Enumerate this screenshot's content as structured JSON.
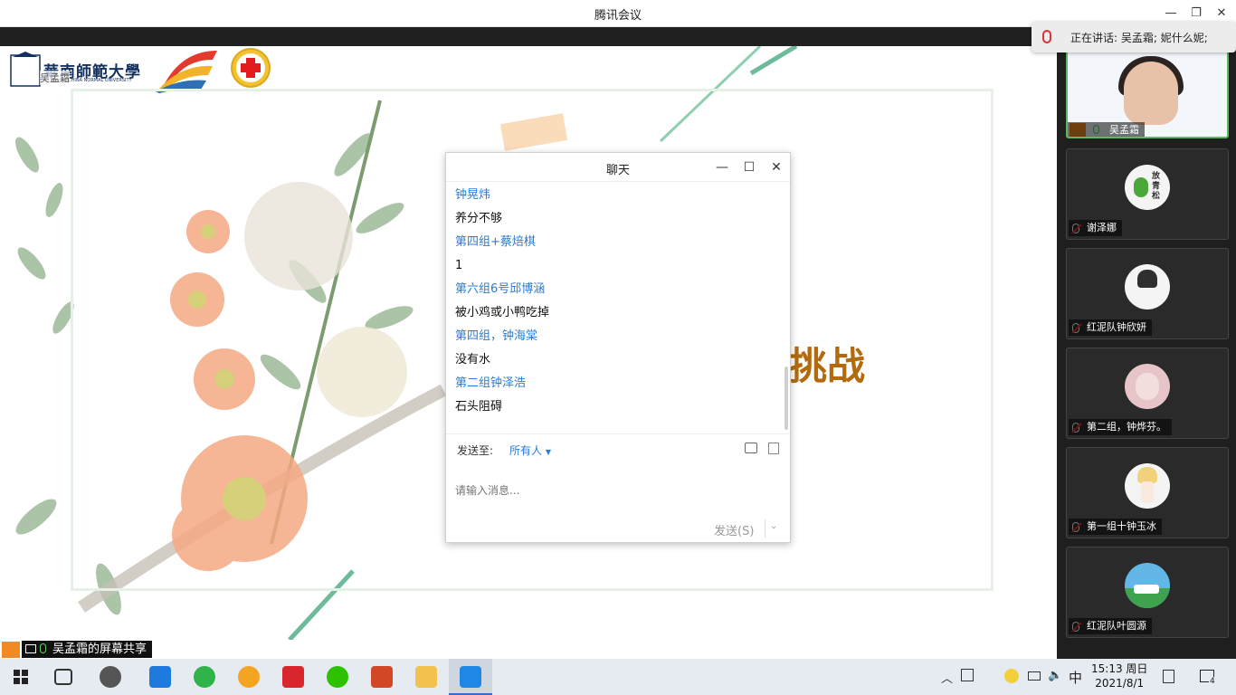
{
  "app": {
    "title": "腾讯会议",
    "speaking_label": "正在讲话: 吴孟霜; 妮什么妮;"
  },
  "share": {
    "sharer_label": "吴孟霜的屏幕共享",
    "slide_partial_title": "挑战",
    "logo_text": "華南師範大學",
    "logo_sub": "SOUTH CHINA NORMAL UNIVERSITY",
    "tag": "吴孟霜"
  },
  "chat": {
    "title": "聊天",
    "messages": [
      {
        "name": "钟晃炜",
        "text": "养分不够"
      },
      {
        "name": "第四组+蔡焙棋",
        "text": "1"
      },
      {
        "name": "第六组6号邱博涵",
        "text": "被小鸡或小鸭吃掉"
      },
      {
        "name": "第四组，钟海棠",
        "text": "没有水"
      },
      {
        "name": "第二组钟泽浩",
        "text": "石头阻碍"
      }
    ],
    "send_to_label": "发送至:",
    "send_to_value": "所有人",
    "input_placeholder": "请输入消息...",
    "send_button": "发送(S)"
  },
  "participants": [
    {
      "name": "吴孟霜",
      "video": true
    },
    {
      "name": "谢泽娜",
      "avatar_label": "放青松"
    },
    {
      "name": "红泥队钟欣妍"
    },
    {
      "name": "第二组，钟烨芬。"
    },
    {
      "name": "第一组十钟玉冰"
    },
    {
      "name": "红泥队叶圆源"
    }
  ],
  "taskbar": {
    "time": "15:13 周日",
    "date": "2021/8/1",
    "ime": "中",
    "notification_count": "4"
  },
  "colors": {
    "accent_blue": "#2b7cd3",
    "slide_title": "#b26a0d",
    "orange": "#f08a24"
  }
}
